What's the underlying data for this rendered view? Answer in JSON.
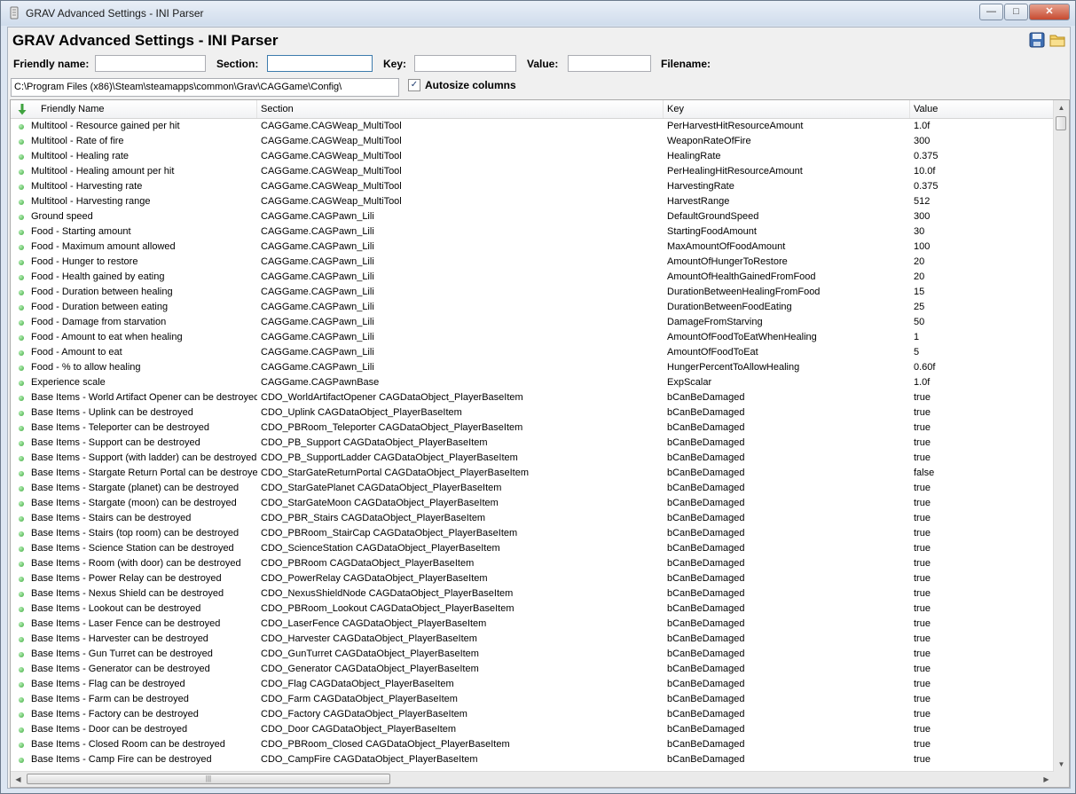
{
  "window": {
    "title": "GRAV Advanced Settings - INI Parser"
  },
  "app": {
    "title": "GRAV Advanced Settings - INI Parser"
  },
  "toolbar": {
    "save_icon": "save-icon",
    "open_icon": "folder-icon"
  },
  "filters": {
    "friendly_label": "Friendly name:",
    "section_label": "Section:",
    "key_label": "Key:",
    "value_label": "Value:",
    "filename_label": "Filename:",
    "friendly_value": "",
    "section_value": "",
    "key_value": "",
    "value_value": ""
  },
  "path": "C:\\Program Files (x86)\\Steam\\steamapps\\common\\Grav\\CAGGame\\Config\\",
  "autosize": {
    "label": "Autosize columns",
    "checked": true
  },
  "columns": [
    "Friendly Name",
    "Section",
    "Key",
    "Value"
  ],
  "rows": [
    [
      "Multitool - Resource gained per hit",
      "CAGGame.CAGWeap_MultiTool",
      "PerHarvestHitResourceAmount",
      "1.0f"
    ],
    [
      "Multitool - Rate of fire",
      "CAGGame.CAGWeap_MultiTool",
      "WeaponRateOfFire",
      "300"
    ],
    [
      "Multitool - Healing rate",
      "CAGGame.CAGWeap_MultiTool",
      "HealingRate",
      "0.375"
    ],
    [
      "Multitool - Healing amount per hit",
      "CAGGame.CAGWeap_MultiTool",
      "PerHealingHitResourceAmount",
      "10.0f"
    ],
    [
      "Multitool - Harvesting rate",
      "CAGGame.CAGWeap_MultiTool",
      "HarvestingRate",
      "0.375"
    ],
    [
      "Multitool - Harvesting range",
      "CAGGame.CAGWeap_MultiTool",
      "HarvestRange",
      "512"
    ],
    [
      "Ground speed",
      "CAGGame.CAGPawn_Lili",
      "DefaultGroundSpeed",
      "300"
    ],
    [
      "Food - Starting amount",
      "CAGGame.CAGPawn_Lili",
      "StartingFoodAmount",
      "30"
    ],
    [
      "Food - Maximum amount allowed",
      "CAGGame.CAGPawn_Lili",
      "MaxAmountOfFoodAmount",
      "100"
    ],
    [
      "Food - Hunger to restore",
      "CAGGame.CAGPawn_Lili",
      "AmountOfHungerToRestore",
      "20"
    ],
    [
      "Food - Health gained by eating",
      "CAGGame.CAGPawn_Lili",
      "AmountOfHealthGainedFromFood",
      "20"
    ],
    [
      "Food - Duration between healing",
      "CAGGame.CAGPawn_Lili",
      "DurationBetweenHealingFromFood",
      "15"
    ],
    [
      "Food - Duration between eating",
      "CAGGame.CAGPawn_Lili",
      "DurationBetweenFoodEating",
      "25"
    ],
    [
      "Food - Damage from starvation",
      "CAGGame.CAGPawn_Lili",
      "DamageFromStarving",
      "50"
    ],
    [
      "Food - Amount to eat when healing",
      "CAGGame.CAGPawn_Lili",
      "AmountOfFoodToEatWhenHealing",
      "1"
    ],
    [
      "Food - Amount to eat",
      "CAGGame.CAGPawn_Lili",
      "AmountOfFoodToEat",
      "5"
    ],
    [
      "Food - % to allow healing",
      "CAGGame.CAGPawn_Lili",
      "HungerPercentToAllowHealing",
      "0.60f"
    ],
    [
      "Experience scale",
      "CAGGame.CAGPawnBase",
      "ExpScalar",
      "1.0f"
    ],
    [
      "Base Items - World Artifact Opener can be destroyed",
      "CDO_WorldArtifactOpener CAGDataObject_PlayerBaseItem",
      "bCanBeDamaged",
      "true"
    ],
    [
      "Base Items - Uplink can be destroyed",
      "CDO_Uplink CAGDataObject_PlayerBaseItem",
      "bCanBeDamaged",
      "true"
    ],
    [
      "Base Items - Teleporter can be destroyed",
      "CDO_PBRoom_Teleporter CAGDataObject_PlayerBaseItem",
      "bCanBeDamaged",
      "true"
    ],
    [
      "Base Items - Support can be destroyed",
      "CDO_PB_Support CAGDataObject_PlayerBaseItem",
      "bCanBeDamaged",
      "true"
    ],
    [
      "Base Items - Support (with ladder) can be destroyed",
      "CDO_PB_SupportLadder CAGDataObject_PlayerBaseItem",
      "bCanBeDamaged",
      "true"
    ],
    [
      "Base Items - Stargate Return Portal can be destroyed",
      "CDO_StarGateReturnPortal CAGDataObject_PlayerBaseItem",
      "bCanBeDamaged",
      "false"
    ],
    [
      "Base Items - Stargate (planet) can be destroyed",
      "CDO_StarGatePlanet CAGDataObject_PlayerBaseItem",
      "bCanBeDamaged",
      "true"
    ],
    [
      "Base Items - Stargate (moon) can be destroyed",
      "CDO_StarGateMoon CAGDataObject_PlayerBaseItem",
      "bCanBeDamaged",
      "true"
    ],
    [
      "Base Items - Stairs can be destroyed",
      "CDO_PBR_Stairs CAGDataObject_PlayerBaseItem",
      "bCanBeDamaged",
      "true"
    ],
    [
      "Base Items - Stairs (top room) can be destroyed",
      "CDO_PBRoom_StairCap CAGDataObject_PlayerBaseItem",
      "bCanBeDamaged",
      "true"
    ],
    [
      "Base Items - Science Station can be destroyed",
      "CDO_ScienceStation CAGDataObject_PlayerBaseItem",
      "bCanBeDamaged",
      "true"
    ],
    [
      "Base Items - Room (with door) can be destroyed",
      "CDO_PBRoom CAGDataObject_PlayerBaseItem",
      "bCanBeDamaged",
      "true"
    ],
    [
      "Base Items - Power Relay can be destroyed",
      "CDO_PowerRelay CAGDataObject_PlayerBaseItem",
      "bCanBeDamaged",
      "true"
    ],
    [
      "Base Items - Nexus Shield can be destroyed",
      "CDO_NexusShieldNode CAGDataObject_PlayerBaseItem",
      "bCanBeDamaged",
      "true"
    ],
    [
      "Base Items - Lookout can be destroyed",
      "CDO_PBRoom_Lookout CAGDataObject_PlayerBaseItem",
      "bCanBeDamaged",
      "true"
    ],
    [
      "Base Items - Laser Fence can be destroyed",
      "CDO_LaserFence CAGDataObject_PlayerBaseItem",
      "bCanBeDamaged",
      "true"
    ],
    [
      "Base Items - Harvester can be destroyed",
      "CDO_Harvester CAGDataObject_PlayerBaseItem",
      "bCanBeDamaged",
      "true"
    ],
    [
      "Base Items - Gun Turret can be destroyed",
      "CDO_GunTurret CAGDataObject_PlayerBaseItem",
      "bCanBeDamaged",
      "true"
    ],
    [
      "Base Items - Generator can be destroyed",
      "CDO_Generator CAGDataObject_PlayerBaseItem",
      "bCanBeDamaged",
      "true"
    ],
    [
      "Base Items - Flag can be destroyed",
      "CDO_Flag CAGDataObject_PlayerBaseItem",
      "bCanBeDamaged",
      "true"
    ],
    [
      "Base Items - Farm can be destroyed",
      "CDO_Farm CAGDataObject_PlayerBaseItem",
      "bCanBeDamaged",
      "true"
    ],
    [
      "Base Items - Factory can be destroyed",
      "CDO_Factory CAGDataObject_PlayerBaseItem",
      "bCanBeDamaged",
      "true"
    ],
    [
      "Base Items - Door can be destroyed",
      "CDO_Door CAGDataObject_PlayerBaseItem",
      "bCanBeDamaged",
      "true"
    ],
    [
      "Base Items - Closed Room can be destroyed",
      "CDO_PBRoom_Closed CAGDataObject_PlayerBaseItem",
      "bCanBeDamaged",
      "true"
    ],
    [
      "Base Items - Camp Fire can be destroyed",
      "CDO_CampFire CAGDataObject_PlayerBaseItem",
      "bCanBeDamaged",
      "true"
    ]
  ]
}
